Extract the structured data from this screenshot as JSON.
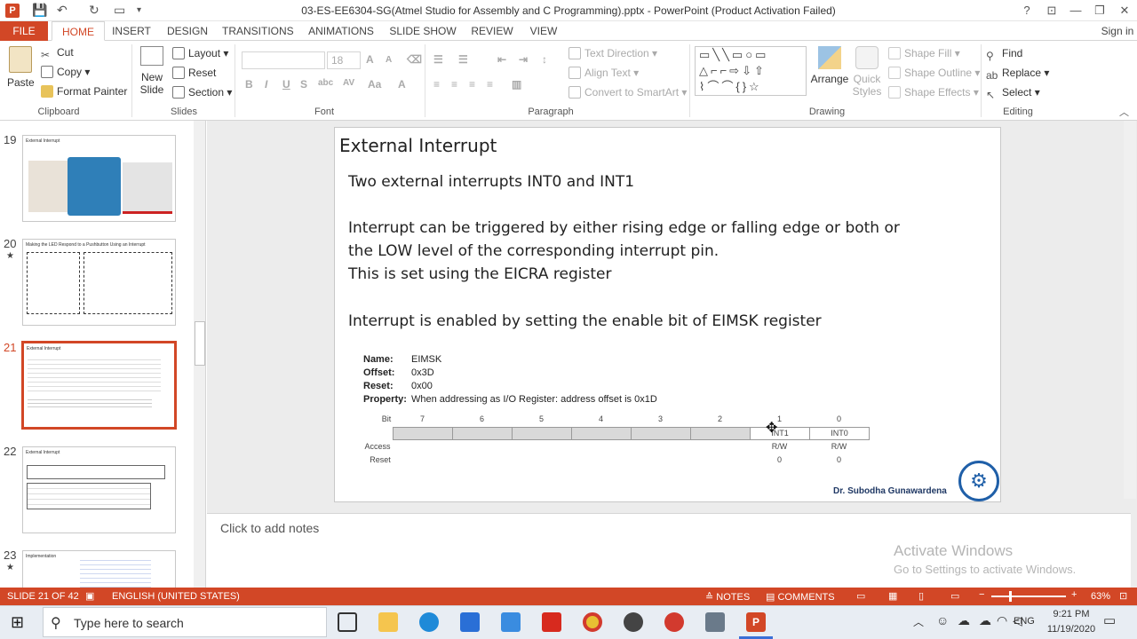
{
  "titlebar": {
    "title": "03-ES-EE6304-SG(Atmel Studio for Assembly and C Programming).pptx - PowerPoint (Product Activation Failed)",
    "help": "?",
    "signin": "Sign in"
  },
  "tabs": [
    "FILE",
    "HOME",
    "INSERT",
    "DESIGN",
    "TRANSITIONS",
    "ANIMATIONS",
    "SLIDE SHOW",
    "REVIEW",
    "VIEW"
  ],
  "ribbon": {
    "clipboard": {
      "paste": "Paste",
      "cut": "Cut",
      "copy": "Copy",
      "format_painter": "Format Painter",
      "label": "Clipboard"
    },
    "slides": {
      "new_slide_1": "New",
      "new_slide_2": "Slide",
      "layout": "Layout",
      "reset": "Reset",
      "section": "Section",
      "label": "Slides"
    },
    "font": {
      "size": "18",
      "label": "Font"
    },
    "paragraph": {
      "text_direction": "Text Direction",
      "align_text": "Align Text",
      "convert": "Convert to SmartArt",
      "label": "Paragraph"
    },
    "drawing": {
      "arrange": "Arrange",
      "quick_1": "Quick",
      "quick_2": "Styles",
      "shape_fill": "Shape Fill",
      "shape_outline": "Shape Outline",
      "shape_effects": "Shape Effects",
      "label": "Drawing"
    },
    "editing": {
      "find": "Find",
      "replace": "Replace",
      "select": "Select",
      "label": "Editing"
    }
  },
  "thumbnails": [
    {
      "num": "19",
      "title": "External Interrupt",
      "star": ""
    },
    {
      "num": "20",
      "title": "Making the LED Respond to a Pushbutton Using an Interrupt",
      "star": "★"
    },
    {
      "num": "21",
      "title": "External Interrupt",
      "star": ""
    },
    {
      "num": "22",
      "title": "External Interrupt",
      "star": ""
    },
    {
      "num": "23",
      "title": "Implementation",
      "star": "★"
    }
  ],
  "slide": {
    "title": "External Interrupt",
    "b1": "Two external interrupts INT0 and INT1",
    "b2": "Interrupt can be triggered by either rising edge or falling edge or both or",
    "b3": "the LOW level of the corresponding interrupt pin.",
    "b4": "This is set using the EICRA register",
    "b5": "Interrupt is enabled by setting the enable bit of EIMSK register",
    "reg": {
      "name_k": "Name:",
      "name_v": "EIMSK",
      "offset_k": "Offset:",
      "offset_v": "0x3D",
      "reset_k": "Reset:",
      "reset_v": "0x00",
      "prop_k": "Property:",
      "prop_v": "When addressing as I/O Register: address offset is 0x1D",
      "bit_label": "Bit",
      "access_label": "Access",
      "reset_label": "Reset",
      "bits": [
        "7",
        "6",
        "5",
        "4",
        "3",
        "2",
        "1",
        "0"
      ],
      "int1": "INT1",
      "int0": "INT0",
      "access1": "R/W",
      "access0": "R/W",
      "reset1": "0",
      "reset0": "0"
    },
    "author": "Dr. Subodha Gunawardena"
  },
  "notes_placeholder": "Click to add notes",
  "watermark": {
    "line1": "Activate Windows",
    "line2": "Go to Settings to activate Windows."
  },
  "statusbar": {
    "slide": "SLIDE 21 OF 42",
    "lang": "ENGLISH (UNITED STATES)",
    "notes": "NOTES",
    "comments": "COMMENTS",
    "zoom": "63%"
  },
  "taskbar": {
    "search": "Type here to search",
    "time": "9:21 PM",
    "date": "11/19/2020",
    "lang": "ENG"
  },
  "colors": {
    "accent": "#d24726"
  }
}
